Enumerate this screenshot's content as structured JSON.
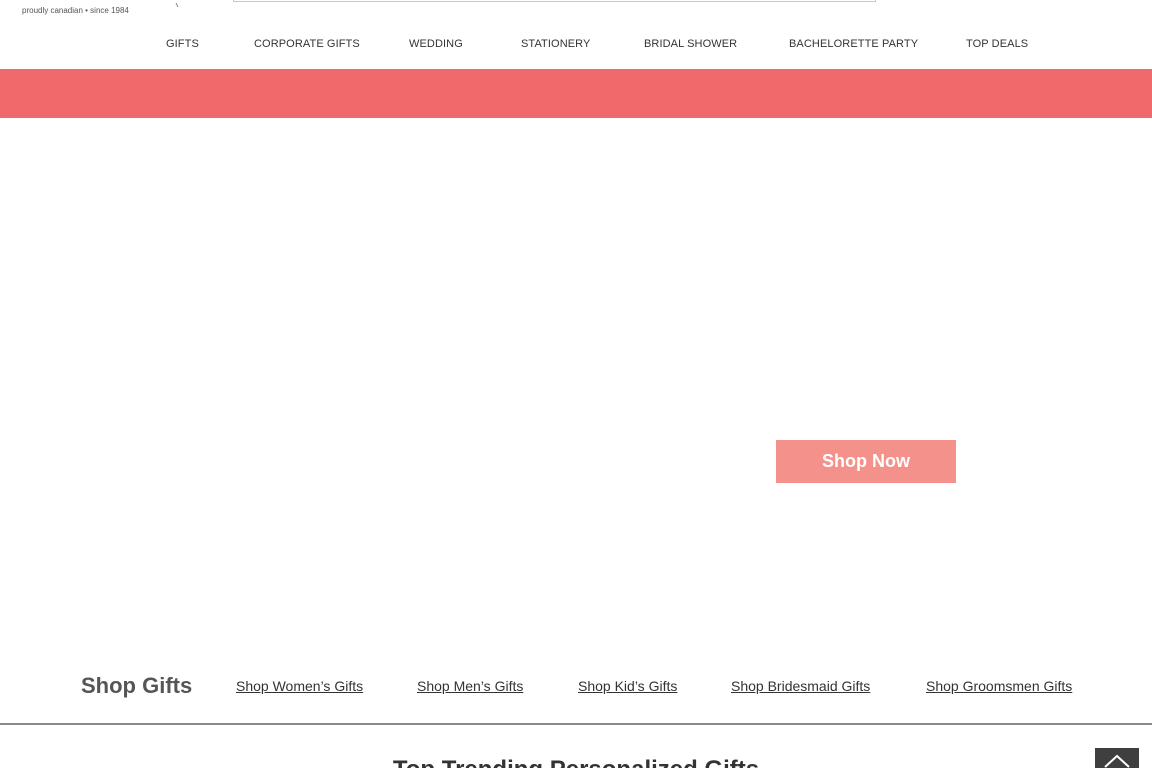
{
  "header": {
    "logo_tagline": "proudly canadian • since 1984",
    "search_placeholder": ""
  },
  "nav": {
    "items": [
      {
        "label": "GIFTS"
      },
      {
        "label": "CORPORATE GIFTS"
      },
      {
        "label": "WEDDING"
      },
      {
        "label": "STATIONERY"
      },
      {
        "label": "BRIDAL SHOWER"
      },
      {
        "label": "BACHELORETTE PARTY"
      },
      {
        "label": "TOP DEALS"
      }
    ]
  },
  "hero": {
    "cta_label": "Shop Now"
  },
  "shop_gifts": {
    "title": "Shop Gifts",
    "links": [
      {
        "label": "Shop Women’s Gifts"
      },
      {
        "label": "Shop Men’s Gifts"
      },
      {
        "label": "Shop Kid’s Gifts"
      },
      {
        "label": "Shop Bridesmaid Gifts"
      },
      {
        "label": "Shop Groomsmen Gifts"
      }
    ]
  },
  "trending": {
    "heading": "Top Trending Personalized Gifts"
  },
  "back_to_top": {
    "icon": "chevron-up-icon"
  },
  "colors": {
    "banner": "#f0696b",
    "cta": "#f4918a",
    "back_to_top": "#3f3f3f"
  }
}
